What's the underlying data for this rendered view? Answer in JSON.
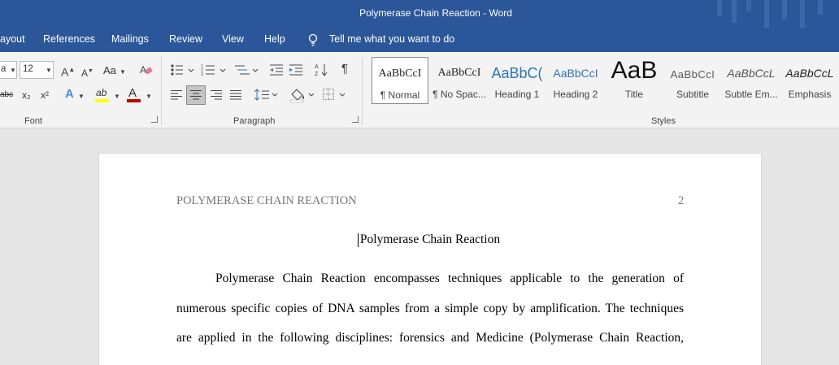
{
  "window": {
    "title": "Polymerase Chain Reaction  -  Word"
  },
  "tabs": [
    {
      "label": "ayout"
    },
    {
      "label": "References"
    },
    {
      "label": "Mailings"
    },
    {
      "label": "Review"
    },
    {
      "label": "View"
    },
    {
      "label": "Help"
    }
  ],
  "tell_me": {
    "label": "Tell me what you want to do"
  },
  "font": {
    "name_value": "a",
    "size_value": "12",
    "change_case": "Aa",
    "strike_label": "abc",
    "sub_label": "x₂",
    "sup_label": "x²",
    "text_effects": "A",
    "highlight_label": "ab",
    "font_color_label": "A",
    "group_label": "Font"
  },
  "paragraph": {
    "group_label": "Paragraph"
  },
  "styles": {
    "group_label": "Styles",
    "items": [
      {
        "preview": "AaBbCcI",
        "name": "¶ Normal"
      },
      {
        "preview": "AaBbCcI",
        "name": "¶ No Spac..."
      },
      {
        "preview": "AaBbC(",
        "name": "Heading 1"
      },
      {
        "preview": "AaBbCcI",
        "name": "Heading 2"
      },
      {
        "preview": "AaB",
        "name": "Title"
      },
      {
        "preview": "AaBbCcI",
        "name": "Subtitle"
      },
      {
        "preview": "AaBbCcL",
        "name": "Subtle Em..."
      },
      {
        "preview": "AaBbCcL",
        "name": "Emphasis"
      }
    ]
  },
  "document": {
    "running_head": "POLYMERASE CHAIN REACTION",
    "page_number": "2",
    "title": "Polymerase Chain Reaction",
    "lines": [
      "Polymerase Chain Reaction encompasses techniques applicable to the generation of",
      "numerous specific copies of DNA samples from a simple copy by amplification. The techniques",
      "are applied in the following disciplines: forensics and Medicine (Polymerase Chain Reaction,"
    ]
  },
  "colors": {
    "accent": "#2b579a",
    "ribbon": "#f3f3f3",
    "canvas": "#e6e6e6",
    "heading_blue": "#2e74b5",
    "font_red": "#c00000",
    "highlight_yellow": "#ffff00"
  }
}
